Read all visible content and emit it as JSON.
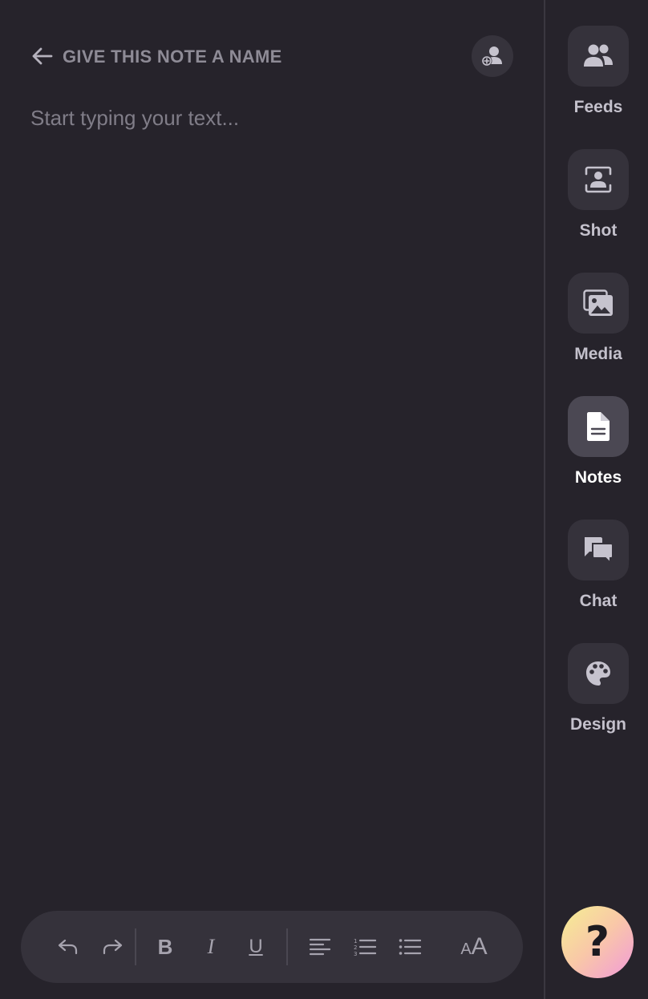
{
  "header": {
    "back_icon": "arrow-left-icon",
    "title": "GIVE THIS NOTE A NAME",
    "share_icon": "add-person-icon"
  },
  "editor": {
    "value": "",
    "placeholder": "Start typing your text..."
  },
  "toolbar": {
    "items": [
      {
        "name": "undo",
        "icon": "undo-icon"
      },
      {
        "name": "redo",
        "icon": "redo-icon"
      },
      {
        "name": "bold",
        "label": "B"
      },
      {
        "name": "italic",
        "label": "I"
      },
      {
        "name": "underline",
        "label": "U"
      },
      {
        "name": "align-left",
        "icon": "align-left-icon"
      },
      {
        "name": "numbered-list",
        "icon": "numbered-list-icon"
      },
      {
        "name": "bulleted-list",
        "icon": "bulleted-list-icon"
      },
      {
        "name": "font-size",
        "label_small": "A",
        "label_large": "A"
      }
    ]
  },
  "rail": {
    "items": [
      {
        "label": "Feeds",
        "icon": "people-icon",
        "active": false
      },
      {
        "label": "Shot",
        "icon": "portrait-frame-icon",
        "active": false
      },
      {
        "label": "Media",
        "icon": "images-icon",
        "active": false
      },
      {
        "label": "Notes",
        "icon": "document-icon",
        "active": true
      },
      {
        "label": "Chat",
        "icon": "chat-bubbles-icon",
        "active": false
      },
      {
        "label": "Design",
        "icon": "palette-icon",
        "active": false
      }
    ]
  },
  "help": {
    "glyph": "?"
  },
  "colors": {
    "background": "#26232b",
    "surface": "#35323b",
    "surface_active": "#4b4853",
    "muted_text": "#8e8b96",
    "help_gradient": [
      "#f5ef92",
      "#f9c7a8",
      "#f19ad9"
    ]
  }
}
